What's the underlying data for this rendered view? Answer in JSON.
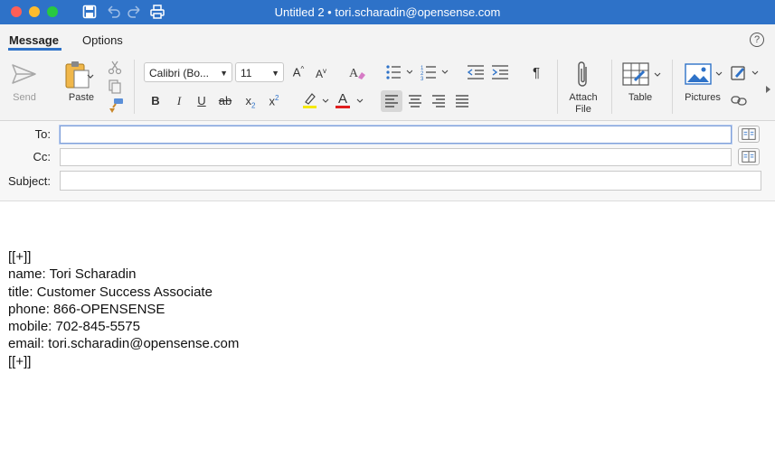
{
  "window": {
    "title": "Untitled 2 • tori.scharadin@opensense.com",
    "traffic_colors": {
      "close": "#fe5f57",
      "minimize": "#febc2e",
      "zoom": "#28c840"
    },
    "quick_icons": [
      "save-icon",
      "undo-icon",
      "redo-icon",
      "print-icon"
    ]
  },
  "tabs": [
    {
      "label": "Message",
      "active": true
    },
    {
      "label": "Options",
      "active": false
    }
  ],
  "help_label": "?",
  "ribbon": {
    "send_label": "Send",
    "paste_label": "Paste",
    "font_name": "Calibri (Bo...",
    "font_size": "11",
    "grow_font": "A",
    "shrink_font": "A",
    "bold": "B",
    "italic": "I",
    "underline": "U",
    "strike": "ab",
    "subscript": "x",
    "subscript_mark": "2",
    "superscript": "x",
    "superscript_mark": "2",
    "font_color_letter": "A",
    "paragraph_mark": "¶",
    "attach_label_1": "Attach",
    "attach_label_2": "File",
    "table_label": "Table",
    "pictures_label": "Pictures",
    "highlight_color": "#f5e90a",
    "font_color": "#e01e1e"
  },
  "headers": {
    "to_label": "To:",
    "cc_label": "Cc:",
    "subject_label": "Subject:",
    "to_value": "",
    "cc_value": "",
    "subject_value": ""
  },
  "body": {
    "lines": [
      "[[+]]",
      "name: Tori Scharadin",
      "title: Customer Success Associate",
      "phone: 866-OPENSENSE",
      "mobile: 702-845-5575",
      "email: tori.scharadin@opensense.com",
      "[[+]]"
    ]
  },
  "accent_color": "#2e72c8"
}
